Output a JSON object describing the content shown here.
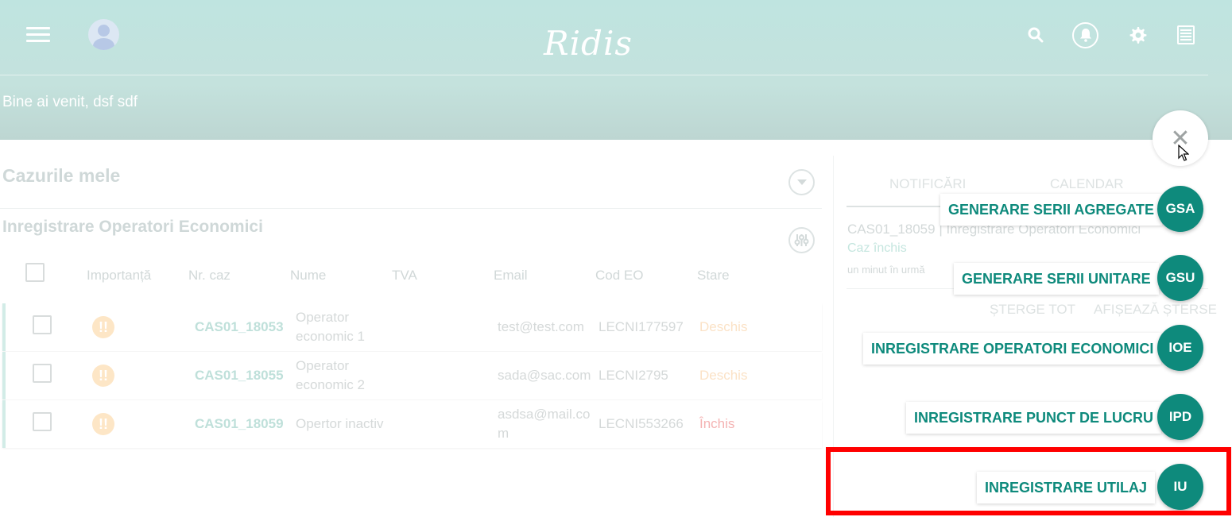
{
  "header": {
    "logo": "Ridis",
    "welcome": "Bine ai venit, dsf sdf",
    "icons": [
      "search-icon",
      "bell-icon",
      "gear-icon",
      "list-icon"
    ]
  },
  "cases": {
    "title": "Cazurile mele",
    "subtitle": "Inregistrare Operatori Economici",
    "columns": [
      "Importanță",
      "Nr. caz",
      "Nume",
      "TVA",
      "Email",
      "Cod EO",
      "Stare"
    ],
    "rows": [
      {
        "importance": "!!",
        "case_no": "CAS01_18053",
        "name_l1": "Operator",
        "name_l2": "economic 1",
        "tva": "",
        "email_l1": "test@test.com",
        "email_l2": "",
        "code": "LECNI177597",
        "status": "Deschis"
      },
      {
        "importance": "!!",
        "case_no": "CAS01_18055",
        "name_l1": "Operator",
        "name_l2": "economic 2",
        "tva": "",
        "email_l1": "sada@sac.com",
        "email_l2": "",
        "code": "LECNI2795",
        "status": "Deschis"
      },
      {
        "importance": "!!",
        "case_no": "CAS01_18059",
        "name_l1": "Opertor inactiv",
        "name_l2": "",
        "tva": "",
        "email_l1": "asdsa@mail.co",
        "email_l2": "m",
        "code": "LECNI553266",
        "status": "Închis"
      }
    ]
  },
  "side": {
    "tabs": [
      "NOTIFICĂRI",
      "CALENDAR"
    ],
    "notification": {
      "title": "CAS01_18059 | Inregistrare Operatori Economici",
      "status": "Caz închis",
      "time": "un minut în urmă"
    },
    "actions": [
      "ȘTERGE TOT",
      "AFIȘEAZĂ ȘTERSE"
    ]
  },
  "fab": {
    "close": "✕",
    "items": [
      {
        "abbr": "GSA",
        "label": "GENERARE SERII AGREGATE"
      },
      {
        "abbr": "GSU",
        "label": "GENERARE SERII UNITARE"
      },
      {
        "abbr": "IOE",
        "label": "INREGISTRARE OPERATORI ECONOMICI"
      },
      {
        "abbr": "IPD",
        "label": "INREGISTRARE PUNCT DE LUCRU"
      },
      {
        "abbr": "IU",
        "label": "INREGISTRARE UTILAJ"
      }
    ]
  },
  "colors": {
    "accent": "#0e8a7c",
    "header": "#bfe4e0",
    "highlight": "#ff0000"
  }
}
